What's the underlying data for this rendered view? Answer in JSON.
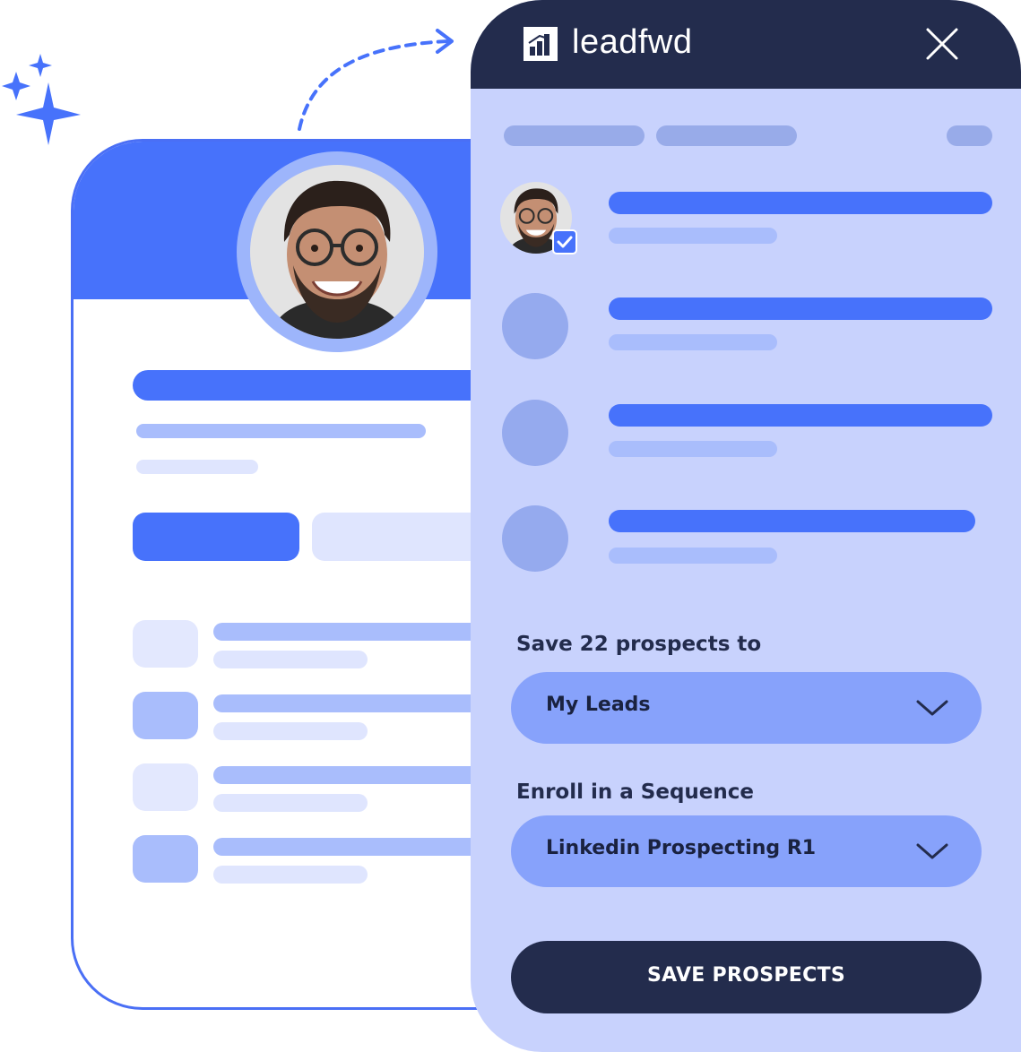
{
  "colors": {
    "accent": "#4772fb",
    "navy": "#232c4d",
    "panel_bg": "#c8d2fd",
    "select_bg": "#87a2fb",
    "light_bar": "#a9bdfc",
    "lighter_bar": "#dfe5fe"
  },
  "icons": {
    "sparkles": "sparkles-icon",
    "arrow": "dashed-arrow-icon",
    "logo": "leadfwd-logo-icon",
    "close": "close-icon",
    "check": "checkbox-checked-icon",
    "chevron": "chevron-down-icon"
  },
  "panel": {
    "brand": "leadfwd",
    "save_label_prefix": "Save 22 prospects to",
    "list_select": {
      "value": "My Leads"
    },
    "sequence_label": "Enroll in a Sequence",
    "sequence_select": {
      "value": "Linkedin Prospecting R1"
    },
    "save_button": "SAVE PROSPECTS"
  },
  "prospects": {
    "selected_count": 1,
    "total_rows": 4
  }
}
